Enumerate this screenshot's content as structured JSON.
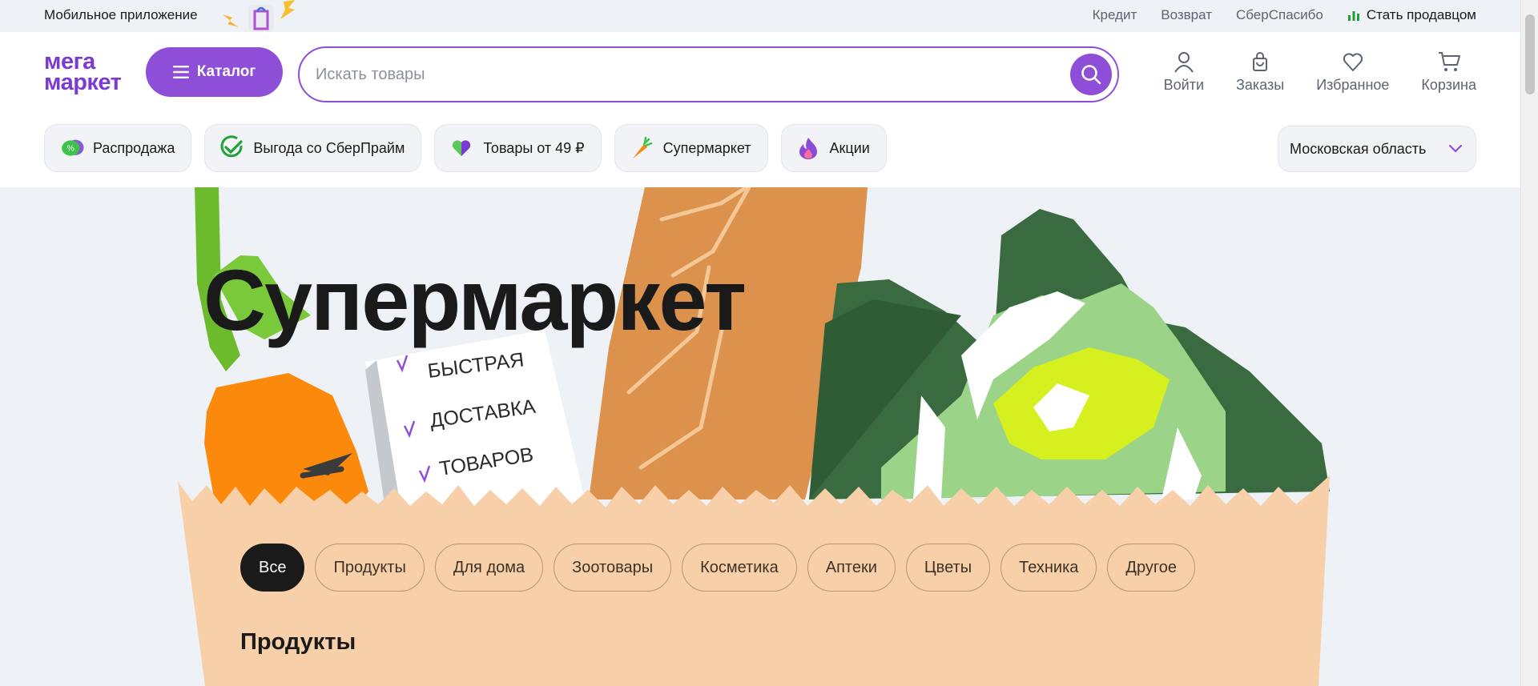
{
  "topbar": {
    "app_label": "Мобильное приложение",
    "links": [
      "Кредит",
      "Возврат",
      "СберСпасибо"
    ],
    "seller_label": "Стать продавцом"
  },
  "header": {
    "logo_line1": "мега",
    "logo_line2": "маркет",
    "catalog_label": "Каталог",
    "search_placeholder": "Искать товары",
    "nav": [
      {
        "label": "Войти",
        "icon": "user-icon"
      },
      {
        "label": "Заказы",
        "icon": "bag-icon"
      },
      {
        "label": "Избранное",
        "icon": "heart-icon"
      },
      {
        "label": "Корзина",
        "icon": "cart-icon"
      }
    ],
    "chips": [
      {
        "label": "Распродажа",
        "icon": "percent-badge-icon"
      },
      {
        "label": "Выгода со СберПрайм",
        "icon": "check-circle-icon"
      },
      {
        "label": "Товары от 49 ₽",
        "icon": "heart-icon"
      },
      {
        "label": "Супермаркет",
        "icon": "carrot-icon"
      },
      {
        "label": "Акции",
        "icon": "flame-icon"
      }
    ],
    "region": "Московская область"
  },
  "hero": {
    "title": "Супермаркет",
    "note_lines": [
      "БЫСТРАЯ",
      "ДОСТАВКА",
      "ТОВАРОВ"
    ],
    "filters": [
      "Все",
      "Продукты",
      "Для дома",
      "Зоотовары",
      "Косметика",
      "Аптеки",
      "Цветы",
      "Техника",
      "Другое"
    ],
    "active_filter": "Все",
    "section_title": "Продукты"
  },
  "colors": {
    "brand": "#8f4ed8",
    "bag": "#f7cfa9",
    "carrot": "#fb8a0c",
    "baguette": "#dc914c",
    "leaves": "#3a6a40"
  }
}
